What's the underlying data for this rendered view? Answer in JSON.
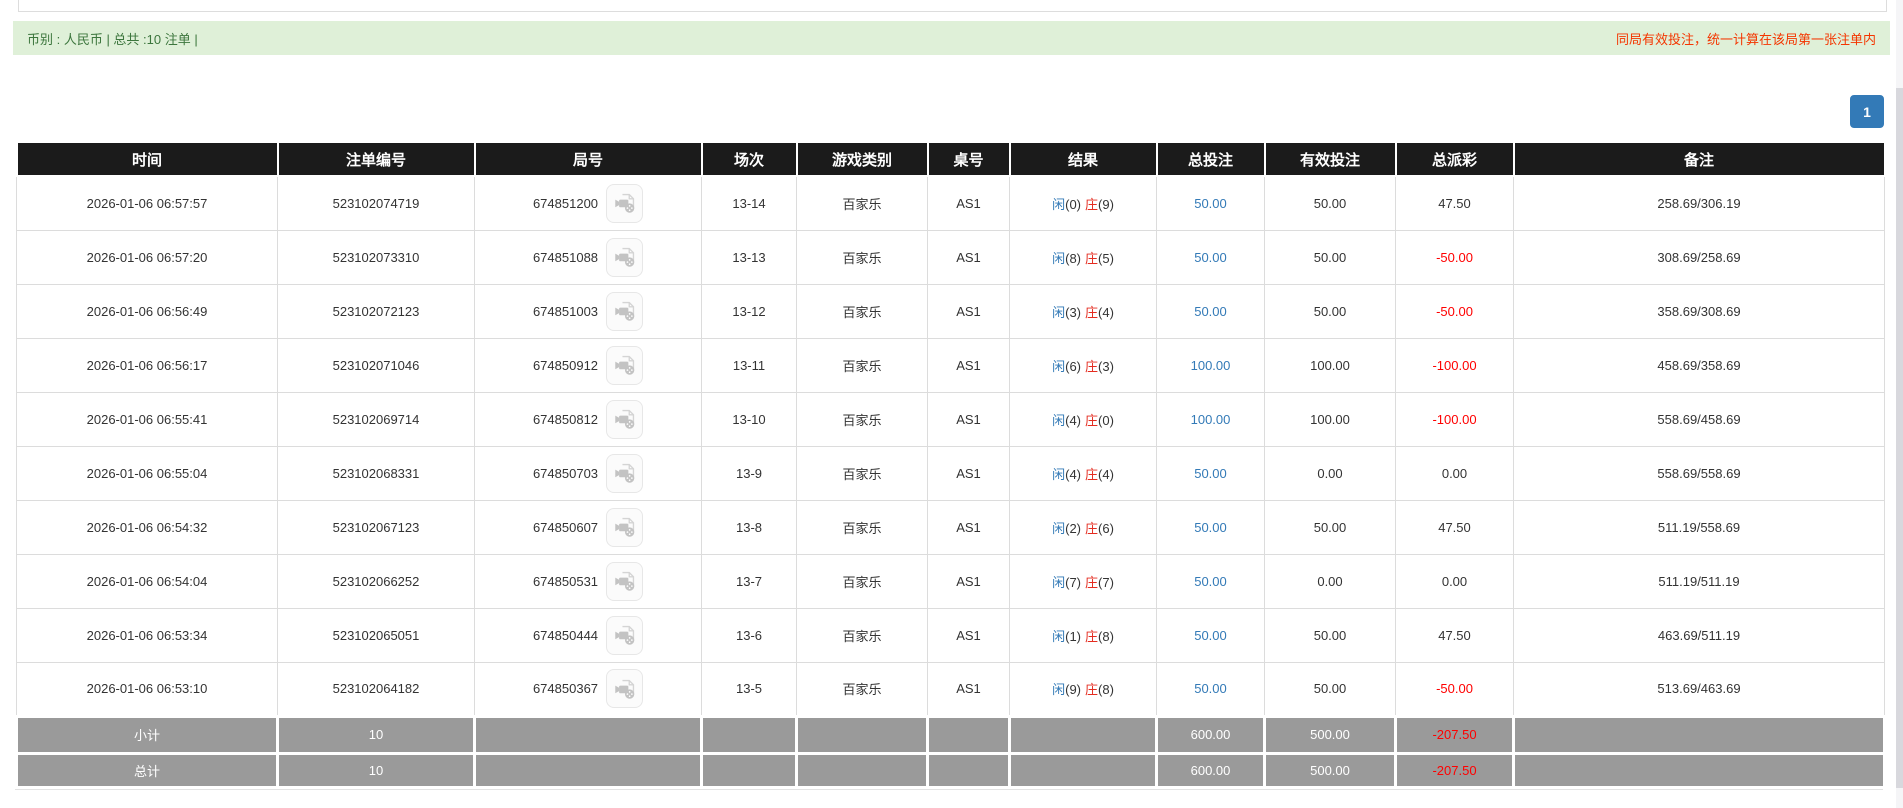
{
  "info_bar": {
    "left_text": "币别 : 人民币 | 总共 :10 注单 |",
    "right_text": "同局有效投注，统一计算在该局第一张注单内"
  },
  "pagination": {
    "current_page": "1"
  },
  "colors": {
    "header_bg": "#1b1b1b",
    "alert_bg": "#dff0d8",
    "alert_text": "#3c763d",
    "warning_text": "#f43600",
    "link_blue": "#337ab7",
    "loss_red": "#ff0000",
    "footer_gray": "#9a9a9a",
    "pager_blue": "#337ab7"
  },
  "icons": {
    "round_video": "video-replay-icon"
  },
  "table": {
    "columns": [
      "时间",
      "注单编号",
      "局号",
      "场次",
      "游戏类别",
      "桌号",
      "结果",
      "总投注",
      "有效投注",
      "总派彩",
      "备注"
    ],
    "rows": [
      {
        "time": "2026-01-06 06:57:57",
        "bet_no": "523102074719",
        "round_no": "674851200",
        "session": "13-14",
        "game": "百家乐",
        "table_no": "AS1",
        "res_p": "闲",
        "res_p_n": "(0)",
        "res_b": "庄",
        "res_b_n": "(9)",
        "total_bet": "50.00",
        "valid_bet": "50.00",
        "payout": "47.50",
        "payout_red": false,
        "note": "258.69/306.19"
      },
      {
        "time": "2026-01-06 06:57:20",
        "bet_no": "523102073310",
        "round_no": "674851088",
        "session": "13-13",
        "game": "百家乐",
        "table_no": "AS1",
        "res_p": "闲",
        "res_p_n": "(8)",
        "res_b": "庄",
        "res_b_n": "(5)",
        "total_bet": "50.00",
        "valid_bet": "50.00",
        "payout": "-50.00",
        "payout_red": true,
        "note": "308.69/258.69"
      },
      {
        "time": "2026-01-06 06:56:49",
        "bet_no": "523102072123",
        "round_no": "674851003",
        "session": "13-12",
        "game": "百家乐",
        "table_no": "AS1",
        "res_p": "闲",
        "res_p_n": "(3)",
        "res_b": "庄",
        "res_b_n": "(4)",
        "total_bet": "50.00",
        "valid_bet": "50.00",
        "payout": "-50.00",
        "payout_red": true,
        "note": "358.69/308.69"
      },
      {
        "time": "2026-01-06 06:56:17",
        "bet_no": "523102071046",
        "round_no": "674850912",
        "session": "13-11",
        "game": "百家乐",
        "table_no": "AS1",
        "res_p": "闲",
        "res_p_n": "(6)",
        "res_b": "庄",
        "res_b_n": "(3)",
        "total_bet": "100.00",
        "valid_bet": "100.00",
        "payout": "-100.00",
        "payout_red": true,
        "note": "458.69/358.69"
      },
      {
        "time": "2026-01-06 06:55:41",
        "bet_no": "523102069714",
        "round_no": "674850812",
        "session": "13-10",
        "game": "百家乐",
        "table_no": "AS1",
        "res_p": "闲",
        "res_p_n": "(4)",
        "res_b": "庄",
        "res_b_n": "(0)",
        "total_bet": "100.00",
        "valid_bet": "100.00",
        "payout": "-100.00",
        "payout_red": true,
        "note": "558.69/458.69"
      },
      {
        "time": "2026-01-06 06:55:04",
        "bet_no": "523102068331",
        "round_no": "674850703",
        "session": "13-9",
        "game": "百家乐",
        "table_no": "AS1",
        "res_p": "闲",
        "res_p_n": "(4)",
        "res_b": "庄",
        "res_b_n": "(4)",
        "total_bet": "50.00",
        "valid_bet": "0.00",
        "payout": "0.00",
        "payout_red": false,
        "note": "558.69/558.69"
      },
      {
        "time": "2026-01-06 06:54:32",
        "bet_no": "523102067123",
        "round_no": "674850607",
        "session": "13-8",
        "game": "百家乐",
        "table_no": "AS1",
        "res_p": "闲",
        "res_p_n": "(2)",
        "res_b": "庄",
        "res_b_n": "(6)",
        "total_bet": "50.00",
        "valid_bet": "50.00",
        "payout": "47.50",
        "payout_red": false,
        "note": "511.19/558.69"
      },
      {
        "time": "2026-01-06 06:54:04",
        "bet_no": "523102066252",
        "round_no": "674850531",
        "session": "13-7",
        "game": "百家乐",
        "table_no": "AS1",
        "res_p": "闲",
        "res_p_n": "(7)",
        "res_b": "庄",
        "res_b_n": "(7)",
        "total_bet": "50.00",
        "valid_bet": "0.00",
        "payout": "0.00",
        "payout_red": false,
        "note": "511.19/511.19"
      },
      {
        "time": "2026-01-06 06:53:34",
        "bet_no": "523102065051",
        "round_no": "674850444",
        "session": "13-6",
        "game": "百家乐",
        "table_no": "AS1",
        "res_p": "闲",
        "res_p_n": "(1)",
        "res_b": "庄",
        "res_b_n": "(8)",
        "total_bet": "50.00",
        "valid_bet": "50.00",
        "payout": "47.50",
        "payout_red": false,
        "note": "463.69/511.19"
      },
      {
        "time": "2026-01-06 06:53:10",
        "bet_no": "523102064182",
        "round_no": "674850367",
        "session": "13-5",
        "game": "百家乐",
        "table_no": "AS1",
        "res_p": "闲",
        "res_p_n": "(9)",
        "res_b": "庄",
        "res_b_n": "(8)",
        "total_bet": "50.00",
        "valid_bet": "50.00",
        "payout": "-50.00",
        "payout_red": true,
        "note": "513.69/463.69"
      }
    ],
    "summary": {
      "subtotal": {
        "label": "小计",
        "count": "10",
        "total_bet": "600.00",
        "valid_bet": "500.00",
        "payout": "-207.50"
      },
      "total": {
        "label": "总计",
        "count": "10",
        "total_bet": "600.00",
        "valid_bet": "500.00",
        "payout": "-207.50"
      }
    }
  }
}
